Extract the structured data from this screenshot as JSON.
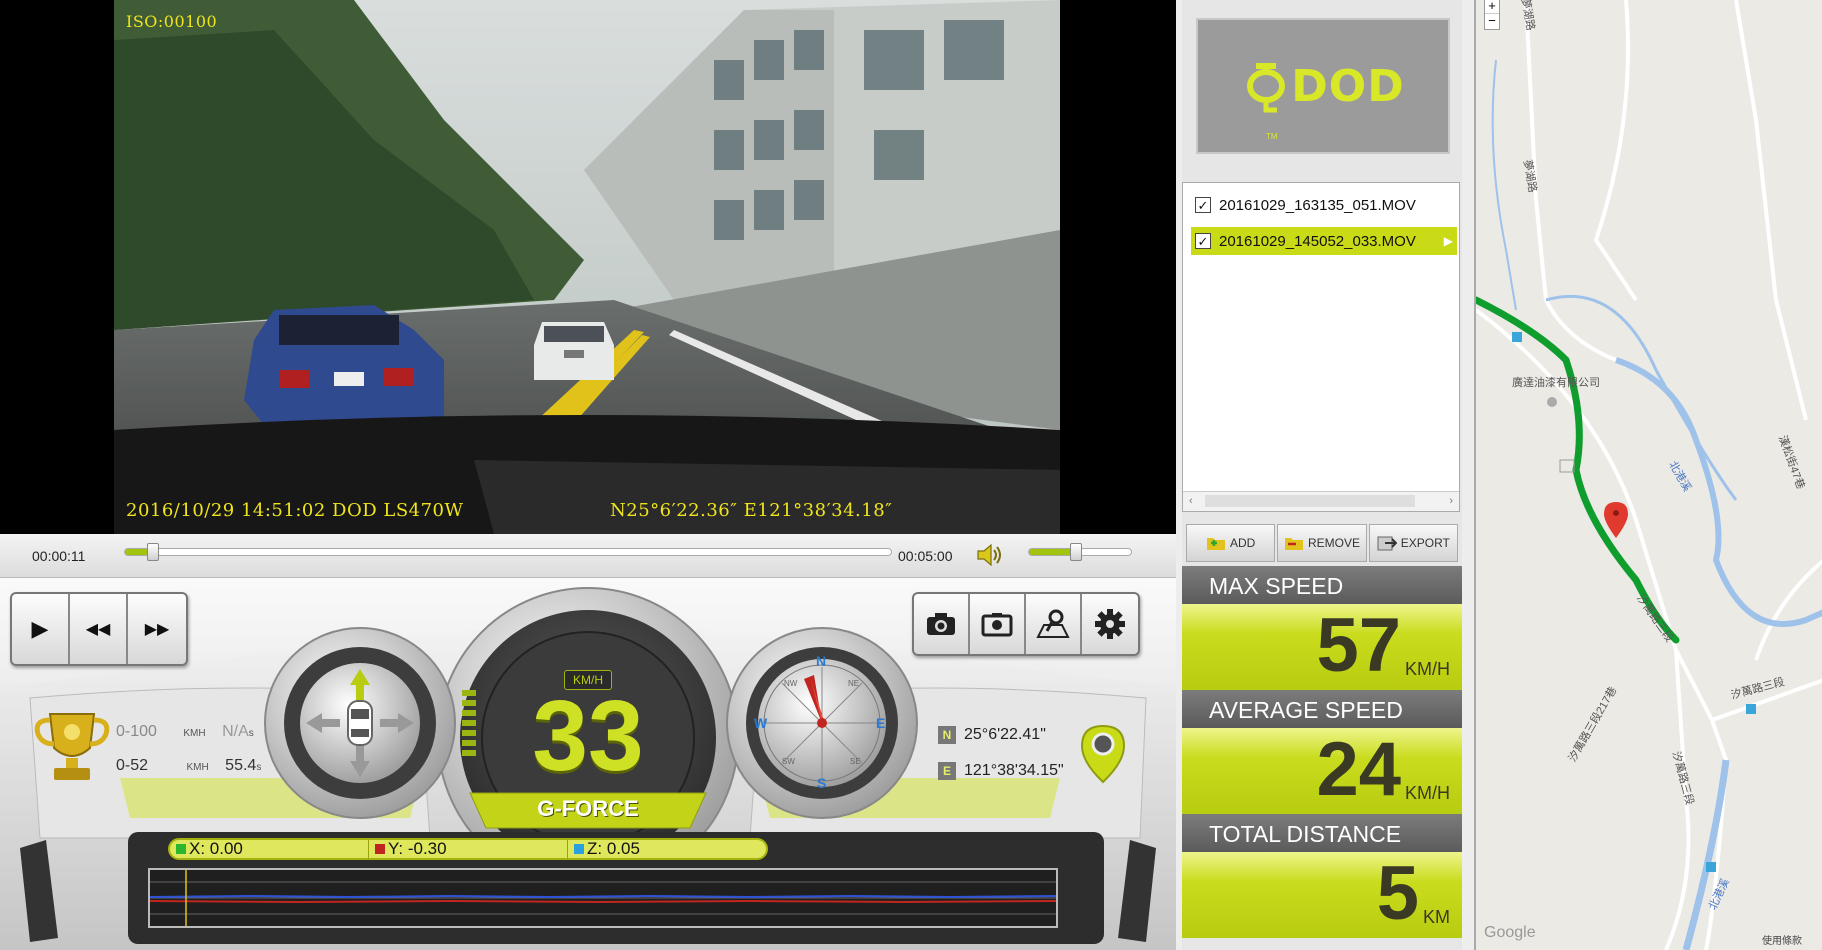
{
  "video": {
    "osd_iso": "ISO:00100",
    "osd_datetime": "2016/10/29 14:51:02 DOD LS470W",
    "osd_coords": "N25°6′22.36″ E121°38′34.18″"
  },
  "timeline": {
    "current_time": "00:00:11",
    "total_time": "00:05:00",
    "progress": 0.037,
    "volume": 0.46
  },
  "controls": {
    "play_icon": "▶",
    "rewind_icon": "◀◀",
    "forward_icon": "▶▶",
    "tools": [
      "camera-icon",
      "snapshot-icon",
      "map-pin-icon",
      "gear-icon"
    ]
  },
  "stats": {
    "row1_label": "0-100",
    "row1_unit": "KMH",
    "row1_value": "N/A",
    "row1_suffix": "s",
    "row2_label": "0-52",
    "row2_unit": "KMH",
    "row2_value": "55.4",
    "row2_suffix": "s"
  },
  "speedometer": {
    "unit": "KM/H",
    "speed": "33"
  },
  "compass": {
    "n": "N",
    "e": "E",
    "s": "S",
    "w": "W",
    "ne": "NE",
    "se": "SE",
    "sw": "SW",
    "nw": "NW"
  },
  "gps": {
    "lat_tag": "N",
    "lat": "25°6'22.41\"",
    "lon_tag": "E",
    "lon": "121°38'34.15\""
  },
  "gforce": {
    "title": "G-FORCE",
    "x_label": "X: 0.00",
    "y_label": "Y: -0.30",
    "z_label": "Z: 0.05",
    "x_color": "#2db52d",
    "y_color": "#c0261f",
    "z_color": "#2aa0e0"
  },
  "right_panel": {
    "logo": "DOD",
    "logo_tm": "TM",
    "files": [
      {
        "name": "20161029_163135_051.MOV",
        "checked": true,
        "selected": false
      },
      {
        "name": "20161029_145052_033.MOV",
        "checked": true,
        "selected": true
      }
    ],
    "add_label": "ADD",
    "remove_label": "REMOVE",
    "export_label": "EXPORT",
    "max_speed_label": "MAX SPEED",
    "max_speed_value": "57",
    "max_speed_unit": "KM/H",
    "avg_speed_label": "AVERAGE SPEED",
    "avg_speed_value": "24",
    "avg_speed_unit": "KM/H",
    "distance_label": "TOTAL DISTANCE",
    "distance_value": "5",
    "distance_unit": "KM"
  },
  "map": {
    "zoom_in": "+",
    "zoom_out": "−",
    "label_company": "廣達油漆有限公司",
    "label_river": "北港溪",
    "label_river2": "北港溪",
    "label_road1": "汐萬路三段",
    "label_road2": "汐萬路三段217巷",
    "label_road3": "汐萬路三段",
    "label_road4": "汐萬路三段",
    "label_top": "夢湖路",
    "label_top2": "夢湖路",
    "label_right": "漢松街47巷",
    "label_google": "Google",
    "label_terms": "使用條款"
  }
}
